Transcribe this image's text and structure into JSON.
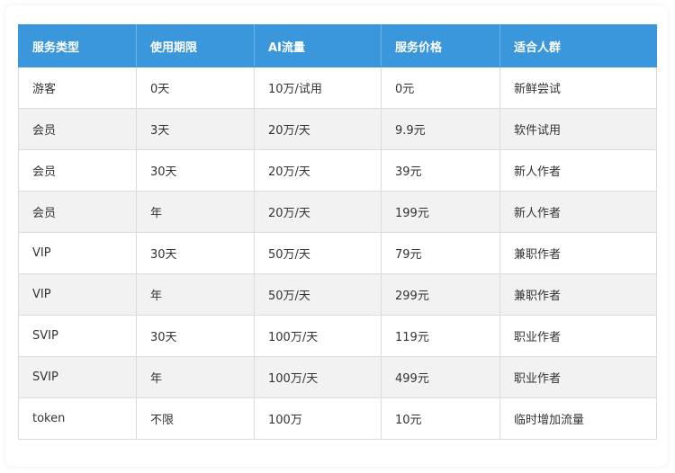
{
  "table": {
    "headers": [
      "服务类型",
      "使用期限",
      "AI流量",
      "服务价格",
      "适合人群"
    ],
    "rows": [
      [
        "游客",
        "0天",
        "10万/试用",
        "0元",
        "新鲜尝试"
      ],
      [
        "会员",
        "3天",
        "20万/天",
        "9.9元",
        "软件试用"
      ],
      [
        "会员",
        "30天",
        "20万/天",
        "39元",
        "新人作者"
      ],
      [
        "会员",
        "年",
        "20万/天",
        "199元",
        "新人作者"
      ],
      [
        "VIP",
        "30天",
        "50万/天",
        "79元",
        "兼职作者"
      ],
      [
        "VIP",
        "年",
        "50万/天",
        "299元",
        "兼职作者"
      ],
      [
        "SVIP",
        "30天",
        "100万/天",
        "119元",
        "职业作者"
      ],
      [
        "SVIP",
        "年",
        "100万/天",
        "499元",
        "职业作者"
      ],
      [
        "token",
        "不限",
        "100万",
        "10元",
        "临时增加流量"
      ]
    ]
  },
  "colors": {
    "header_bg": "#3b97db",
    "header_text": "#ffffff",
    "row_alt_bg": "#f2f2f2",
    "border": "#dcdcdc"
  }
}
